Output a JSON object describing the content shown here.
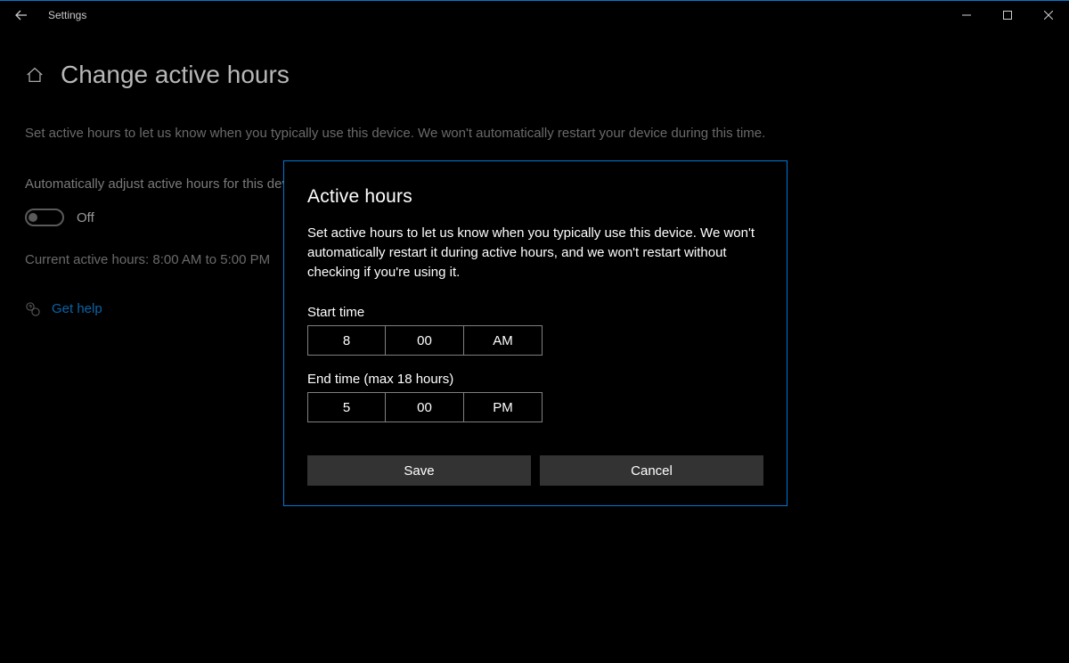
{
  "titlebar": {
    "title": "Settings"
  },
  "page": {
    "heading": "Change active hours",
    "description": "Set active hours to let us know when you typically use this device. We won't automatically restart your device during this time.",
    "auto_adjust_label": "Automatically adjust active hours for this device based on activity",
    "toggle_state": "Off",
    "current_hours": "Current active hours: 8:00 AM to 5:00 PM",
    "help_link": "Get help"
  },
  "modal": {
    "title": "Active hours",
    "description": "Set active hours to let us know when you typically use this device. We won't automatically restart it during active hours, and we won't restart without checking if you're using it.",
    "start_label": "Start time",
    "start": {
      "hour": "8",
      "minute": "00",
      "period": "AM"
    },
    "end_label": "End time (max 18 hours)",
    "end": {
      "hour": "5",
      "minute": "00",
      "period": "PM"
    },
    "save_label": "Save",
    "cancel_label": "Cancel"
  }
}
